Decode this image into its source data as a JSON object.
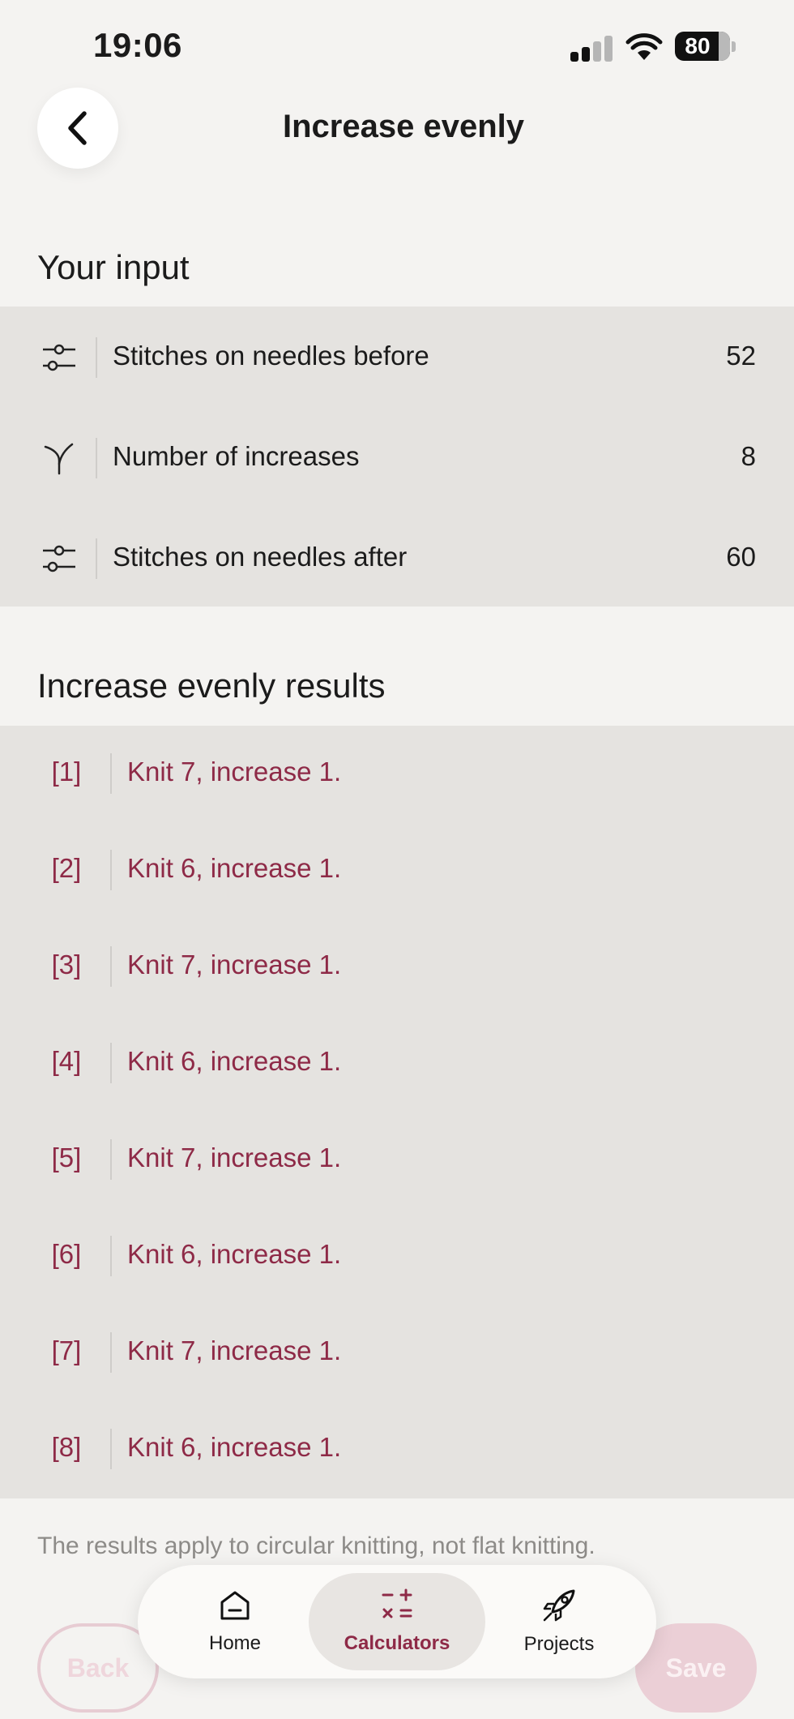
{
  "status_bar": {
    "time": "19:06",
    "battery_percent": "80"
  },
  "header": {
    "title": "Increase evenly",
    "back_icon": "chevron-left-icon"
  },
  "input_section": {
    "title": "Your input",
    "rows": [
      {
        "icon": "sliders-icon",
        "label": "Stitches on needles before",
        "value": "52"
      },
      {
        "icon": "increase-fork-icon",
        "label": "Number of increases",
        "value": "8"
      },
      {
        "icon": "sliders-icon",
        "label": "Stitches on needles after",
        "value": "60"
      }
    ]
  },
  "results_section": {
    "title": "Increase evenly results",
    "rows": [
      {
        "index": "[1]",
        "text": "Knit 7, increase 1."
      },
      {
        "index": "[2]",
        "text": "Knit 6, increase 1."
      },
      {
        "index": "[3]",
        "text": "Knit 7, increase 1."
      },
      {
        "index": "[4]",
        "text": "Knit 6, increase 1."
      },
      {
        "index": "[5]",
        "text": "Knit 7, increase 1."
      },
      {
        "index": "[6]",
        "text": "Knit 6, increase 1."
      },
      {
        "index": "[7]",
        "text": "Knit 7, increase 1."
      },
      {
        "index": "[8]",
        "text": "Knit 6, increase 1."
      }
    ]
  },
  "footnote": "The results apply to circular knitting, not flat knitting.",
  "actions": {
    "back_label": "Back",
    "save_label": "Save"
  },
  "tab_bar": {
    "tabs": [
      {
        "label": "Home",
        "icon": "home-icon",
        "active": false
      },
      {
        "label": "Calculators",
        "icon": "calculator-icon",
        "active": true
      },
      {
        "label": "Projects",
        "icon": "rocket-icon",
        "active": false
      }
    ]
  },
  "colors": {
    "accent": "#8e2a47",
    "panel": "#e5e3e0",
    "background": "#f4f3f1"
  }
}
